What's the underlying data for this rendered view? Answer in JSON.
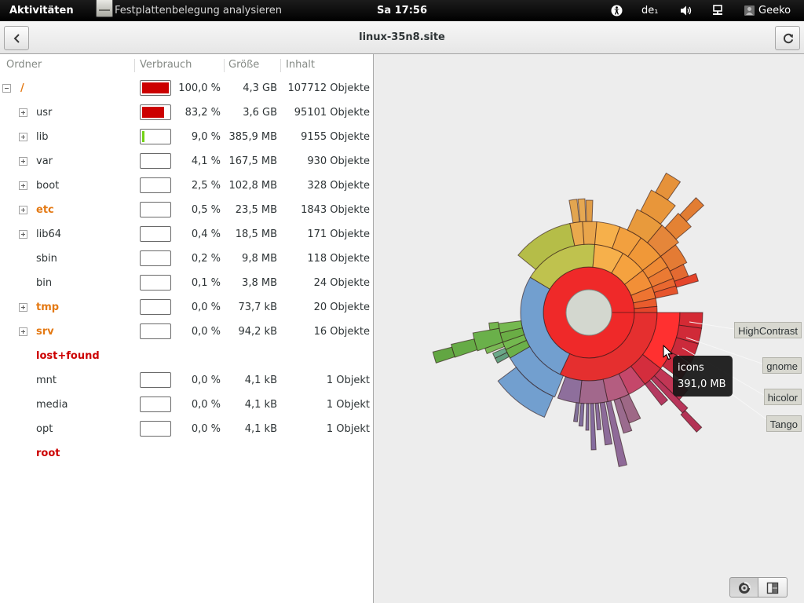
{
  "topbar": {
    "activities": "Aktivitäten",
    "app_name": "Festplattenbelegung analysieren",
    "clock": "Sa 17:56",
    "keyboard_layout": "de₁",
    "user_name": "Geeko"
  },
  "header": {
    "title": "linux-35n8.site"
  },
  "columns": {
    "folder": "Ordner",
    "usage": "Verbrauch",
    "size": "Größe",
    "contents": "Inhalt"
  },
  "rows": [
    {
      "name": "/",
      "depth": 0,
      "expander": "expanded",
      "emphasis": "orange",
      "percent": "100,0 %",
      "size": "4,3 GB",
      "contents": "107712 Objekte",
      "bar_color": "#cc0000"
    },
    {
      "name": "usr",
      "depth": 1,
      "expander": "collapsed",
      "percent": "83,2 %",
      "size": "3,6 GB",
      "contents": "95101 Objekte",
      "bar_color": "#cc0000"
    },
    {
      "name": "lib",
      "depth": 1,
      "expander": "collapsed",
      "percent": "9,0 %",
      "size": "385,9 MB",
      "contents": "9155 Objekte",
      "bar_color": "#73d216"
    },
    {
      "name": "var",
      "depth": 1,
      "expander": "collapsed",
      "percent": "4,1 %",
      "size": "167,5 MB",
      "contents": "930 Objekte"
    },
    {
      "name": "boot",
      "depth": 1,
      "expander": "collapsed",
      "percent": "2,5 %",
      "size": "102,8 MB",
      "contents": "328 Objekte"
    },
    {
      "name": "etc",
      "depth": 1,
      "expander": "collapsed",
      "emphasis": "orange",
      "percent": "0,5 %",
      "size": "23,5 MB",
      "contents": "1843 Objekte"
    },
    {
      "name": "lib64",
      "depth": 1,
      "expander": "collapsed",
      "percent": "0,4 %",
      "size": "18,5 MB",
      "contents": "171 Objekte"
    },
    {
      "name": "sbin",
      "depth": 1,
      "percent": "0,2 %",
      "size": "9,8 MB",
      "contents": "118 Objekte"
    },
    {
      "name": "bin",
      "depth": 1,
      "percent": "0,1 %",
      "size": "3,8 MB",
      "contents": "24 Objekte"
    },
    {
      "name": "tmp",
      "depth": 1,
      "expander": "collapsed",
      "emphasis": "orange",
      "percent": "0,0 %",
      "size": "73,7 kB",
      "contents": "20 Objekte"
    },
    {
      "name": "srv",
      "depth": 1,
      "expander": "collapsed",
      "emphasis": "orange",
      "percent": "0,0 %",
      "size": "94,2 kB",
      "contents": "16 Objekte"
    },
    {
      "name": "lost+found",
      "depth": 1,
      "emphasis": "red"
    },
    {
      "name": "mnt",
      "depth": 1,
      "percent": "0,0 %",
      "size": "4,1 kB",
      "contents": "1 Objekt"
    },
    {
      "name": "media",
      "depth": 1,
      "percent": "0,0 %",
      "size": "4,1 kB",
      "contents": "1 Objekt"
    },
    {
      "name": "opt",
      "depth": 1,
      "percent": "0,0 %",
      "size": "4,1 kB",
      "contents": "1 Objekt"
    },
    {
      "name": "root",
      "depth": 1,
      "emphasis": "red"
    }
  ],
  "ring_chart": {
    "labels": [
      "HighContrast",
      "gnome",
      "hicolor",
      "Tango"
    ],
    "tooltip": {
      "name": "icons",
      "size": "391,0 MB"
    }
  },
  "icons": {
    "app": "disk-usage-analyzer-icon",
    "accessibility": "accessibility-icon",
    "volume": "volume-icon",
    "network": "network-icon",
    "user": "user-icon",
    "back": "go-previous-icon",
    "refresh": "view-refresh-icon",
    "expand": "expander-icon",
    "ring_chart_view": "ring-chart-icon",
    "treemap_view": "treemap-icon",
    "pointer": "mouse-pointer-icon"
  },
  "colors": {
    "folder_emphasis_orange": "#e47913",
    "folder_emphasis_red": "#cc0000",
    "usage_high": "#cc0000",
    "usage_low": "#73d216",
    "hovered_segment": "#ff3030"
  }
}
